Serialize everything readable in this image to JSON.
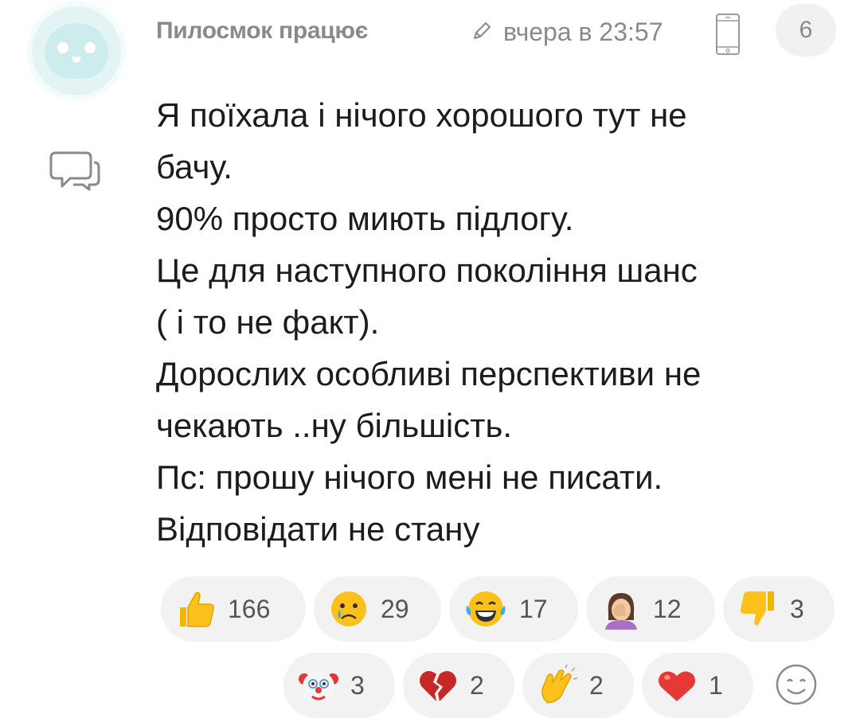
{
  "comment": {
    "author": "Пилосмок працює",
    "timestamp": "вчера в 23:57",
    "reply_count": "6",
    "lines": [
      "Я поїхала і нічого хорошого тут не",
      "бачу.",
      "90% просто миють підлогу.",
      "Це для наступного покоління шанс",
      "( і то не факт).",
      "Дорослих особливі перспективи не",
      "чекають ..ну більшість.",
      "Пс: прошу нічого мені не писати.",
      "Відповідати не стану"
    ]
  },
  "reactions": [
    {
      "icon": "thumbs-up",
      "count": "166"
    },
    {
      "icon": "crying-face",
      "count": "29"
    },
    {
      "icon": "tears-of-joy",
      "count": "17"
    },
    {
      "icon": "facepalm",
      "count": "12"
    },
    {
      "icon": "thumbs-down",
      "count": "3"
    },
    {
      "icon": "clown-face",
      "count": "3"
    },
    {
      "icon": "broken-heart",
      "count": "2"
    },
    {
      "icon": "clapping-hands",
      "count": "2"
    },
    {
      "icon": "red-heart",
      "count": "1"
    }
  ],
  "colors": {
    "meta_text": "#8a8a8a",
    "body_text": "#1c1c1c",
    "pill_bg": "#f2f2f2"
  }
}
